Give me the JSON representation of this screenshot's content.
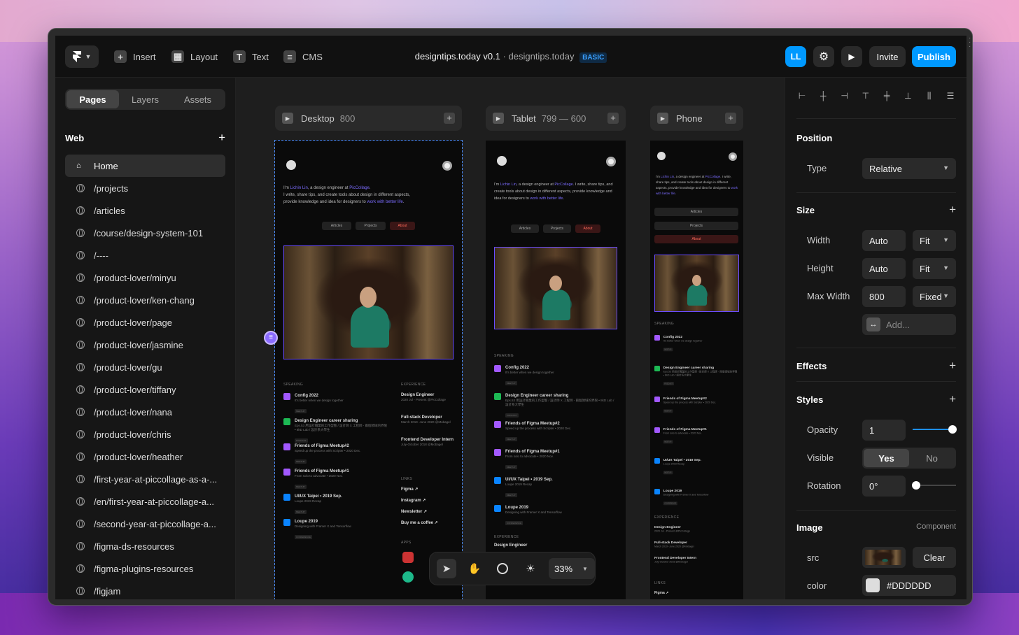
{
  "topbar": {
    "menu": [
      {
        "label": "Insert",
        "icon": "plus-icon"
      },
      {
        "label": "Layout",
        "icon": "layout-icon"
      },
      {
        "label": "Text",
        "icon": "text-icon"
      },
      {
        "label": "CMS",
        "icon": "database-icon"
      }
    ],
    "project_name": "designtips.today v0.1",
    "separator": "·",
    "domain": "designtips.today",
    "plan_badge": "BASIC",
    "avatar_initials": "LL",
    "invite_label": "Invite",
    "publish_label": "Publish",
    "accent": "#0099ff"
  },
  "left": {
    "tabs": [
      "Pages",
      "Layers",
      "Assets"
    ],
    "active_tab": "Pages",
    "section_title": "Web",
    "pages": [
      "Home",
      "/projects",
      "/articles",
      "/course/design-system-101",
      "/----",
      "/product-lover/minyu",
      "/product-lover/ken-chang",
      "/product-lover/page",
      "/product-lover/jasmine",
      "/product-lover/gu",
      "/product-lover/tiffany",
      "/product-lover/nana",
      "/product-lover/chris",
      "/product-lover/heather",
      "/first-year-at-piccollage-as-a-...",
      "/en/first-year-at-piccollage-a...",
      "/second-year-at-piccollage-a...",
      "/figma-ds-resources",
      "/figma-plugins-resources",
      "/figjam"
    ],
    "active_page": "Home"
  },
  "canvas": {
    "frames": [
      {
        "name": "Desktop",
        "size": "800"
      },
      {
        "name": "Tablet",
        "size": "799 — 600"
      },
      {
        "name": "Phone",
        "size": ""
      }
    ],
    "site": {
      "intro_prefix": "I'm ",
      "name": "Lichin Lin",
      "intro_mid": ", a design engineer at ",
      "company": "PicCollage",
      "intro_line2": "I write, share tips, and create tools about design in different aspects,",
      "intro_line3": "provide knowledge and idea for designers to ",
      "tagline_link": "work with better life",
      "nav": [
        "Articles",
        "Projects",
        "About"
      ],
      "speaking_label": "SPEAKING",
      "experience_label": "EXPERIENCE",
      "links_label": "LINKS",
      "apps_label": "APPS",
      "talks": [
        {
          "title": "Config 2022",
          "sub": "It's better when we design together",
          "tag": "MEETUP",
          "color": "#a259ff"
        },
        {
          "title": "Design Engineer career sharing",
          "sub": "Eps.53 用設計職業的工作型態 / 設計師 X 工程師 - 兩個領域的界限 • 8kD Lab / 設計系大學生",
          "tag": "PODCAST",
          "color": "#1db954"
        },
        {
          "title": "Friends of Figma Meetup#2",
          "sub": "Speed up the process with Scripter • 2020 Dec.",
          "tag": "MEETUP",
          "color": "#a259ff"
        },
        {
          "title": "Friends of Figma Meetup#1",
          "sub": "From solo to advocate • 2020 Nov.",
          "tag": "MEETUP",
          "color": "#a259ff"
        },
        {
          "title": "UI/UX Taipei • 2019 Sep.",
          "sub": "Loupe 2019 Recap",
          "tag": "MEETUP",
          "color": "#0a84ff"
        },
        {
          "title": "Loupe 2019",
          "sub": "Designing with Framer X and Tensorflow",
          "tag": "CONFERENCE",
          "color": "#0a84ff"
        }
      ],
      "experience": [
        {
          "title": "Design Engineer",
          "sub": "2020 Jul - Present @PicCollage"
        },
        {
          "title": "Full-stack Developer",
          "sub": "March 2019 -June 2020 @Mobagel"
        },
        {
          "title": "Frontend Developer Intern",
          "sub": "July-October 2018 @Mobagel"
        }
      ],
      "links": [
        "Figma ↗",
        "Instagram ↗",
        "Newsletter ↗",
        "Buy me a coffee ↗"
      ]
    },
    "toolbar": {
      "zoom": "33%",
      "tools": [
        "select-icon",
        "hand-icon",
        "comment-icon",
        "theme-icon"
      ]
    }
  },
  "right": {
    "position_title": "Position",
    "type_label": "Type",
    "type_value": "Relative",
    "size_title": "Size",
    "width_label": "Width",
    "width_value": "Auto",
    "width_mode": "Fit",
    "height_label": "Height",
    "height_value": "Auto",
    "height_mode": "Fit",
    "maxwidth_label": "Max Width",
    "maxwidth_value": "800",
    "maxwidth_mode": "Fixed",
    "add_placeholder": "Add...",
    "effects_title": "Effects",
    "styles_title": "Styles",
    "opacity_label": "Opacity",
    "opacity_value": "1",
    "visible_label": "Visible",
    "visible_options": [
      "Yes",
      "No"
    ],
    "visible_selected": "Yes",
    "rotation_label": "Rotation",
    "rotation_value": "0°",
    "image_title": "Image",
    "image_component": "Component",
    "src_label": "src",
    "clear_label": "Clear",
    "color_label": "color",
    "color_value": "#DDDDDD"
  }
}
